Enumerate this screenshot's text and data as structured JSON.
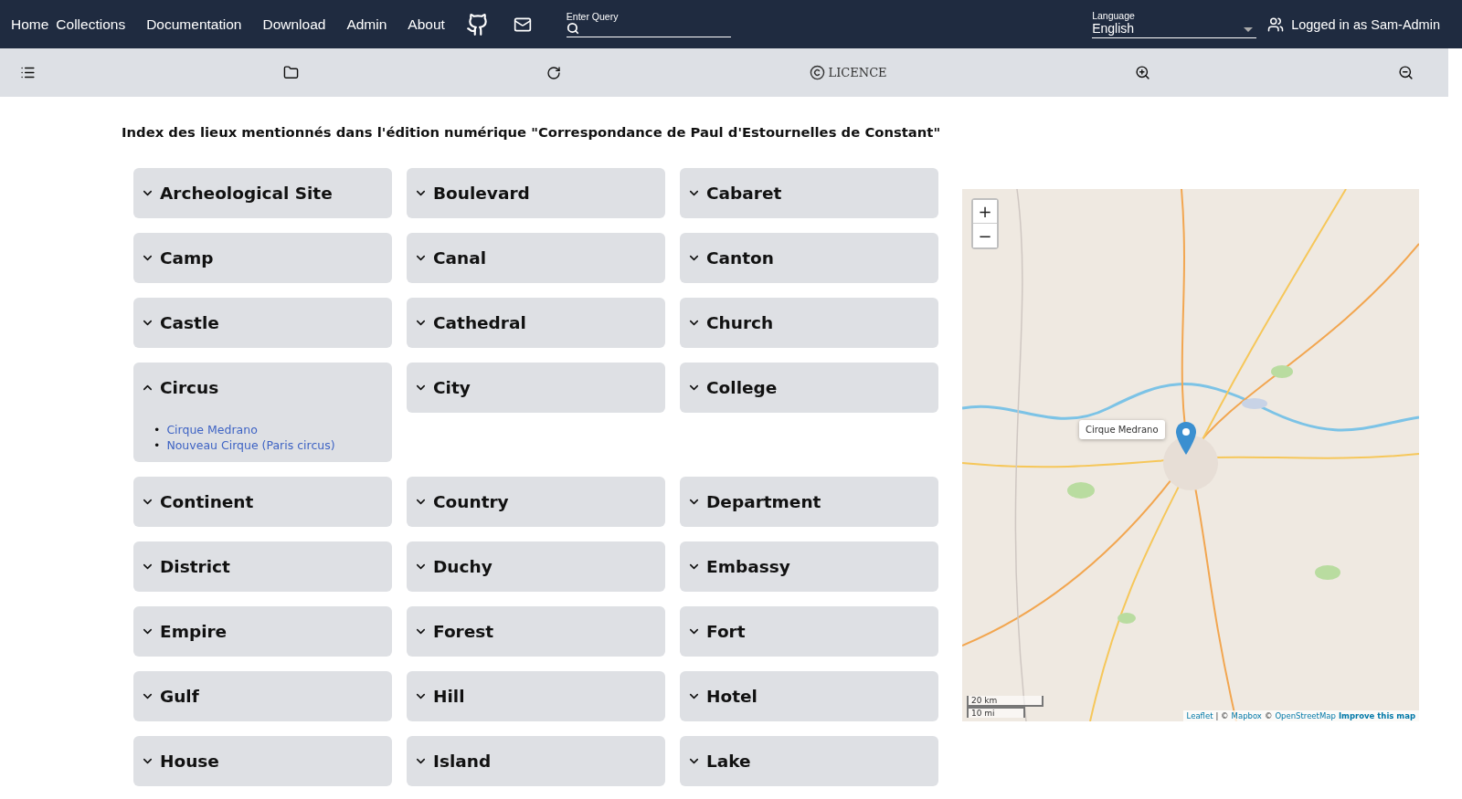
{
  "nav": {
    "links": [
      "Home",
      "Collections",
      "Documentation",
      "Download",
      "Admin",
      "About"
    ],
    "search": {
      "label": "Enter Query"
    },
    "language": {
      "label": "Language",
      "value": "English"
    },
    "user": "Logged in as Sam-Admin"
  },
  "toolbar": {
    "licence": "LICENCE"
  },
  "heading": "Index des lieux mentionnés dans l'édition numérique \"Correspondance de Paul d'Estournelles de Constant\"",
  "categories": [
    {
      "title": "Archeological Site",
      "expanded": false
    },
    {
      "title": "Boulevard",
      "expanded": false
    },
    {
      "title": "Cabaret",
      "expanded": false
    },
    {
      "title": "Camp",
      "expanded": false
    },
    {
      "title": "Canal",
      "expanded": false
    },
    {
      "title": "Canton",
      "expanded": false
    },
    {
      "title": "Castle",
      "expanded": false
    },
    {
      "title": "Cathedral",
      "expanded": false
    },
    {
      "title": "Church",
      "expanded": false
    },
    {
      "title": "Circus",
      "expanded": true,
      "places": [
        {
          "bullet": "•",
          "name": "Cirque Medrano"
        },
        {
          "bullet": "•",
          "name": "Nouveau Cirque (Paris circus)"
        }
      ]
    },
    {
      "title": "City",
      "expanded": false
    },
    {
      "title": "College",
      "expanded": false
    },
    {
      "title": "Continent",
      "expanded": false
    },
    {
      "title": "Country",
      "expanded": false
    },
    {
      "title": "Department",
      "expanded": false
    },
    {
      "title": "District",
      "expanded": false
    },
    {
      "title": "Duchy",
      "expanded": false
    },
    {
      "title": "Embassy",
      "expanded": false
    },
    {
      "title": "Empire",
      "expanded": false
    },
    {
      "title": "Forest",
      "expanded": false
    },
    {
      "title": "Fort",
      "expanded": false
    },
    {
      "title": "Gulf",
      "expanded": false
    },
    {
      "title": "Hill",
      "expanded": false
    },
    {
      "title": "Hotel",
      "expanded": false
    },
    {
      "title": "House",
      "expanded": false
    },
    {
      "title": "Island",
      "expanded": false
    },
    {
      "title": "Lake",
      "expanded": false
    }
  ],
  "map": {
    "zoom_in": "+",
    "zoom_out": "−",
    "popup": "Cirque Medrano",
    "scale": [
      "20 km",
      "10 mi"
    ],
    "attribution": {
      "links": [
        "Leaflet",
        "Mapbox",
        "OpenStreetMap"
      ],
      "separator": "|",
      "copyright": "©",
      "improve": "Improve this map"
    }
  }
}
